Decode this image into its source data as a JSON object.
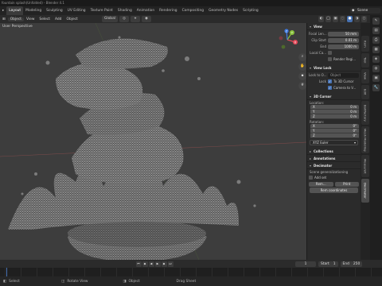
{
  "window": {
    "title": "fountain splash(Unfolded) - Blender 4.1"
  },
  "workspace_tabs": [
    "Layout",
    "Modeling",
    "Sculpting",
    "UV Editing",
    "Texture Paint",
    "Shading",
    "Animation",
    "Rendering",
    "Compositing",
    "Geometry Nodes",
    "Scripting"
  ],
  "active_workspace": "Layout",
  "scene": {
    "label": "Scene"
  },
  "header": {
    "mode": "Object",
    "menus": [
      "View",
      "Select",
      "Add",
      "Object"
    ],
    "orientation": "Global"
  },
  "viewport": {
    "label": "User Perspective",
    "nav_icons": [
      "zoom-icon",
      "hand-icon",
      "camera-icon",
      "grid-icon"
    ],
    "gizmo_axes": [
      "X",
      "Y",
      "Z"
    ],
    "colors": {
      "background": "#3d3d3d",
      "mesh": "#8a8a8a",
      "wire": "#2e2e2e",
      "x_axis": "#e44a5a",
      "y_axis": "#8ac23c",
      "z_axis": "#3f7be3"
    }
  },
  "npanel": {
    "view": {
      "title": "View",
      "focal_label": "Focal Len...",
      "focal_value": "50 mm",
      "clip_start_label": "Clip Start",
      "clip_start_value": "0.01 m",
      "clip_end_label": "End",
      "clip_end_value": "1000 m",
      "local_cam_label": "Local Ca...",
      "render_region_label": "Render Regi..."
    },
    "view_lock": {
      "title": "View Lock",
      "lock_to_label": "Lock to O...",
      "lock_to_placeholder": "Object",
      "lock_label": "Lock",
      "to_cursor_label": "To 3D Cursor",
      "camera_view_label": "Camera to V..."
    },
    "cursor": {
      "title": "3D Cursor",
      "location_label": "Location:",
      "loc": [
        {
          "axis": "X",
          "value": "0 m"
        },
        {
          "axis": "Y",
          "value": "0 m"
        },
        {
          "axis": "Z",
          "value": "0 m"
        }
      ],
      "rotation_label": "Rotation:",
      "rot": [
        {
          "axis": "X",
          "value": "0°"
        },
        {
          "axis": "Y",
          "value": "0°"
        },
        {
          "axis": "Z",
          "value": "0°"
        }
      ],
      "rotation_mode": "XYZ Euler"
    },
    "collections_title": "Collections",
    "annotations_title": "Annotations",
    "decimator": {
      "title": "Decimator",
      "generalization_label": "Scene generalizationing",
      "add_set_label": "Add set",
      "add_set_value": "",
      "btn_a": "Rem...",
      "btn_b": "Print",
      "button": "Rem coordinates"
    }
  },
  "side_tabs": [
    "Item",
    "Tool",
    "View",
    "Edit",
    "Boltfactory",
    "Mesh Modeling",
    "MeasureIt",
    "Decimator"
  ],
  "active_side_tab": "Decimator",
  "timeline": {
    "current_frame": "1",
    "start_label": "Start",
    "start_value": "1",
    "end_label": "End",
    "end_value": "250"
  },
  "statusbar": {
    "left_hint": "Select",
    "mid_hint": "Rotate View",
    "right_hint": "Object",
    "far_hint": "Drag Sheet"
  }
}
